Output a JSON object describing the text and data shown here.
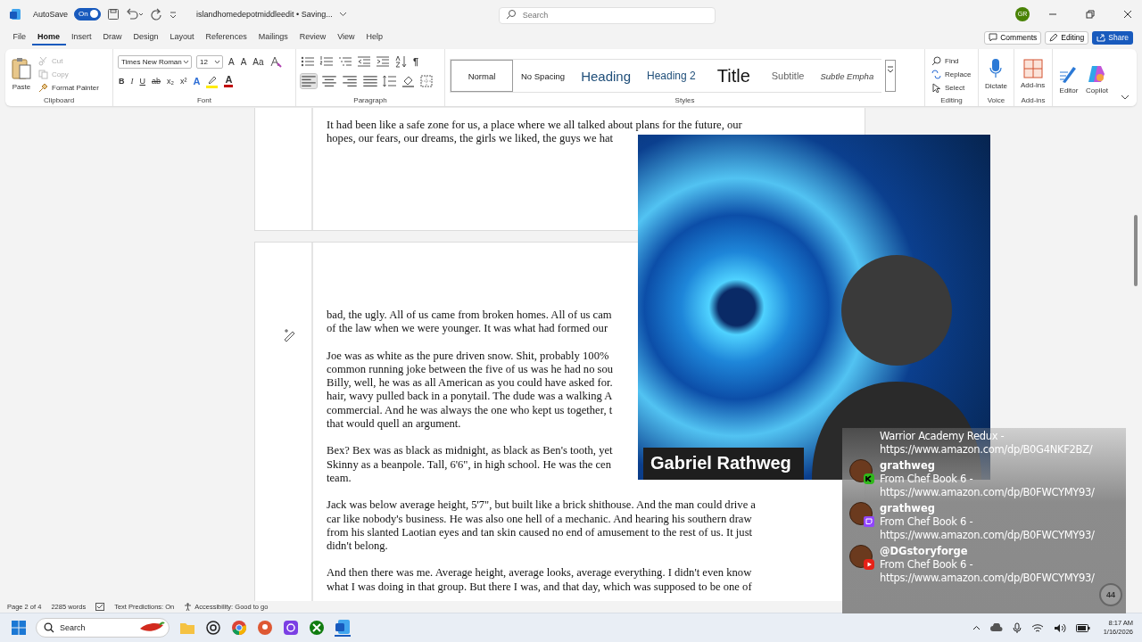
{
  "title_bar": {
    "autosave_label": "AutoSave",
    "autosave": {
      "on": true,
      "label": "On"
    },
    "document_title": "islandhomedepotmiddleedit • Saving...",
    "search": {
      "placeholder": "Search"
    },
    "avatar": "GR"
  },
  "tabs": [
    {
      "label": "File",
      "selected": false
    },
    {
      "label": "Home",
      "selected": true
    },
    {
      "label": "Insert",
      "selected": false
    },
    {
      "label": "Draw",
      "selected": false
    },
    {
      "label": "Design",
      "selected": false
    },
    {
      "label": "Layout",
      "selected": false
    },
    {
      "label": "References",
      "selected": false
    },
    {
      "label": "Mailings",
      "selected": false
    },
    {
      "label": "Review",
      "selected": false
    },
    {
      "label": "View",
      "selected": false
    },
    {
      "label": "Help",
      "selected": false
    }
  ],
  "actions": {
    "comments": "Comments",
    "editing": "Editing",
    "share": "Share"
  },
  "ribbon": {
    "clipboard": {
      "group": "Clipboard",
      "paste": "Paste",
      "items": [
        {
          "label": "Cut",
          "disabled": true
        },
        {
          "label": "Copy",
          "disabled": true
        },
        {
          "label": "Format Painter",
          "disabled": false
        }
      ]
    },
    "font": {
      "group": "Font",
      "name": "Times New Roman",
      "size": "12",
      "size_buttons": [
        "A",
        "A",
        "Aa"
      ],
      "format_buttons": [
        "B",
        "I",
        "U",
        "ab",
        "x₂",
        "x²"
      ],
      "color_buttons": [
        {
          "label": "A",
          "color": "#2f6fd6"
        },
        {
          "label": "A",
          "color": "#c00000"
        }
      ]
    },
    "paragraph": {
      "group": "Paragraph",
      "pilcrow": "¶",
      "alignments": [
        {
          "kind": "left",
          "selected": true
        },
        {
          "kind": "center",
          "selected": false
        },
        {
          "kind": "right",
          "selected": false
        },
        {
          "kind": "justify",
          "selected": false
        }
      ]
    },
    "styles": {
      "group": "Styles",
      "items": [
        {
          "label": "Normal",
          "kind": "normal",
          "selected": true
        },
        {
          "label": "No Spacing",
          "kind": "nospacing",
          "selected": false
        },
        {
          "label": "Heading",
          "kind": "heading",
          "selected": false
        },
        {
          "label": "Heading 2",
          "kind": "heading2",
          "selected": false
        },
        {
          "label": "Title",
          "kind": "title",
          "selected": false
        },
        {
          "label": "Subtitle",
          "kind": "subtitle",
          "selected": false
        },
        {
          "label": "Subtle Empha",
          "kind": "subtle",
          "selected": false
        }
      ]
    },
    "editing": {
      "group": "Editing",
      "items": [
        {
          "label": "Find",
          "kind": "find"
        },
        {
          "label": "Replace",
          "kind": "replace"
        },
        {
          "label": "Select",
          "kind": "select"
        }
      ]
    },
    "voice": {
      "group": "Voice",
      "label": "Dictate"
    },
    "addins": {
      "group": "Add-ins",
      "label": "Add-ins"
    },
    "tools": [
      {
        "label": "Editor",
        "kind": "editor"
      },
      {
        "label": "Copilot",
        "kind": "copilot"
      }
    ]
  },
  "document": {
    "pages": [
      {
        "paragraphs": [
          {
            "lines": [
              "It had been like a safe zone for us, a place where we all talked about plans for the future, our",
              "hopes, our fears, our dreams, the girls we liked, the guys we hat"
            ]
          }
        ]
      },
      {
        "paragraphs": [
          {
            "lines": [
              "bad, the ugly. All of us came from broken homes. All of us cam",
              "of the law when we were younger. It was what had formed our"
            ]
          },
          {
            "lines": [
              "Joe was as white as the pure driven snow. Shit, probably 100%",
              "common running joke between the five of us was he had no sou",
              "Billy, well, he was as all American as you could have asked for.",
              "hair, wavy pulled back in a ponytail. The dude was a walking A",
              "commercial. And he was always the one who kept us together, t",
              "that would quell an argument."
            ]
          },
          {
            "lines": [
              "Bex? Bex was as black as midnight, as black as Ben's tooth, yet",
              "Skinny as a beanpole. Tall, 6'6\", in high school. He was the cen",
              "team."
            ]
          },
          {
            "lines": [
              "Jack was below average height, 5'7\", but built like a brick shithouse. And the man could drive a",
              "car like nobody's business. He was also one hell of a mechanic. And hearing his southern draw",
              "from his slanted Laotian eyes and tan skin caused no end of amusement to the rest of us. It just",
              "didn't belong."
            ]
          },
          {
            "lines": [
              "And then there was me. Average height, average looks, average everything. I didn't even know",
              "what I was doing in that group. But there I was, and that day, which was supposed to be one of"
            ]
          }
        ]
      }
    ]
  },
  "webcam": {
    "name": "Gabriel Rathweg"
  },
  "chat": {
    "messages": [
      {
        "kind": "plain",
        "lines": [
          "Warrior Academy Redux -",
          "https://www.amazon.com/dp/B0G4NKF2BZ/"
        ]
      },
      {
        "kind": "kick",
        "user": "grathweg",
        "lines": [
          "From Chef Book 6 -",
          "https://www.amazon.com/dp/B0FWCYMY93/"
        ]
      },
      {
        "kind": "twitch",
        "user": "grathweg",
        "lines": [
          "From Chef Book 6 -",
          "https://www.amazon.com/dp/B0FWCYMY93/"
        ]
      },
      {
        "kind": "youtube",
        "user": "@DGstoryforge",
        "lines": [
          "From Chef Book 6 -",
          "https://www.amazon.com/dp/B0FWCYMY93/"
        ]
      }
    ],
    "viewer_count": "44"
  },
  "status_bar": {
    "page": "Page 2 of 4",
    "words": "2285 words",
    "predictions": "Text Predictions: On",
    "accessibility": "Accessibility: Good to go"
  },
  "taskbar": {
    "search": "Search",
    "time": "8:17 AM",
    "date": "1/16/2026"
  }
}
